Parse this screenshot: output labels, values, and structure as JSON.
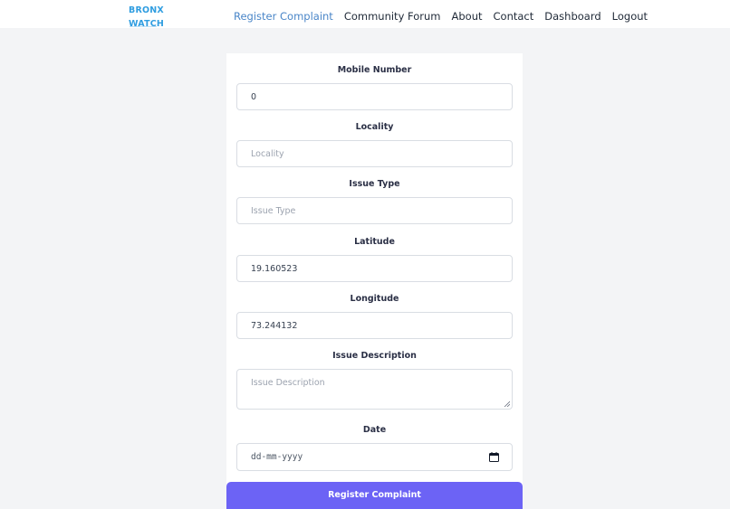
{
  "brand": {
    "line1": "BRONX",
    "line2": "WATCH",
    "color": "#2f9de0"
  },
  "nav": {
    "active_color": "#4a86c8",
    "items": [
      {
        "label": "Register Complaint",
        "active": true
      },
      {
        "label": "Community Forum"
      },
      {
        "label": "About"
      },
      {
        "label": "Contact"
      },
      {
        "label": "Dashboard"
      },
      {
        "label": "Logout"
      }
    ]
  },
  "form": {
    "mobile": {
      "label": "Mobile Number",
      "value": "0",
      "placeholder": "Mobile Number"
    },
    "locality": {
      "label": "Locality",
      "value": "",
      "placeholder": "Locality"
    },
    "issue_type": {
      "label": "Issue Type",
      "value": "",
      "placeholder": "Issue Type"
    },
    "latitude": {
      "label": "Latitude",
      "value": "19.160523",
      "placeholder": "Latitude"
    },
    "longitude": {
      "label": "Longitude",
      "value": "73.244132",
      "placeholder": "Longitude"
    },
    "description": {
      "label": "Issue Description",
      "value": "",
      "placeholder": "Issue Description"
    },
    "date": {
      "label": "Date",
      "placeholder": "dd-mm-yyyy",
      "icon": "calendar-icon"
    },
    "submit_label": "Register Complaint",
    "submit_color": "#6c63f5"
  }
}
